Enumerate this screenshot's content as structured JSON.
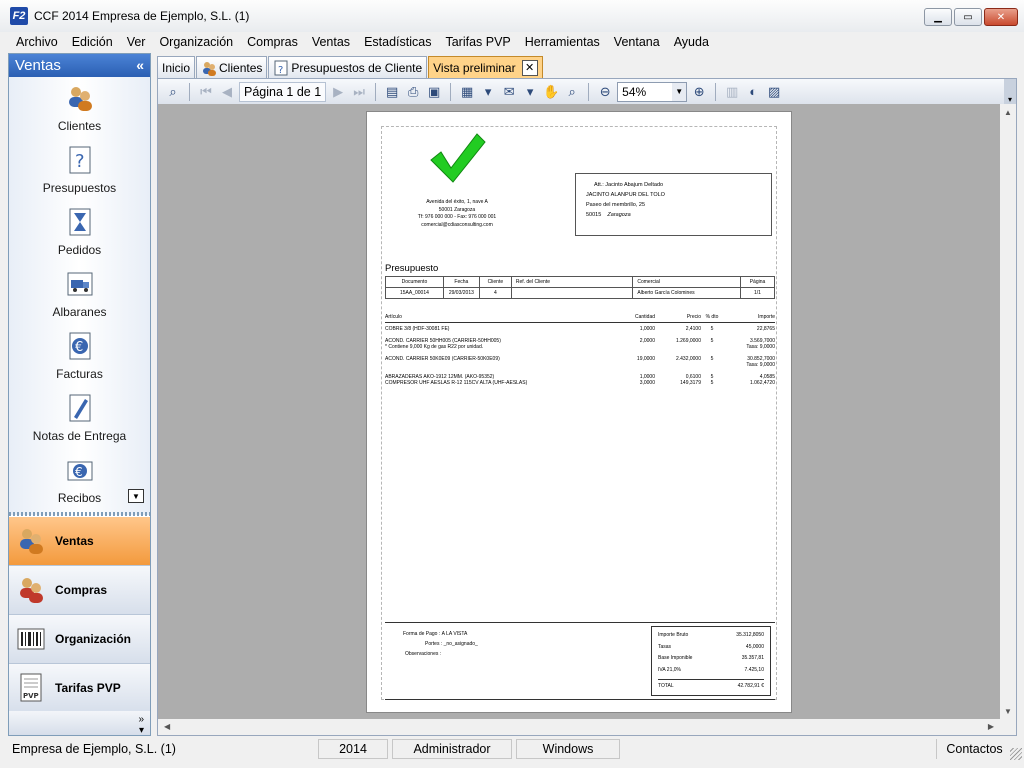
{
  "window": {
    "title": "CCF 2014 Empresa de Ejemplo, S.L. (1)",
    "app_icon": "F2"
  },
  "menu": [
    "Archivo",
    "Edición",
    "Ver",
    "Organización",
    "Compras",
    "Ventas",
    "Estadísticas",
    "Tarifas PVP",
    "Herramientas",
    "Ventana",
    "Ayuda"
  ],
  "sidebar": {
    "title": "Ventas",
    "items": [
      {
        "label": "Clientes",
        "icon": "clients-icon"
      },
      {
        "label": "Presupuestos",
        "icon": "quote-icon"
      },
      {
        "label": "Pedidos",
        "icon": "hourglass-icon"
      },
      {
        "label": "Albaranes",
        "icon": "truck-icon"
      },
      {
        "label": "Facturas",
        "icon": "euro-invoice-icon"
      },
      {
        "label": "Notas de Entrega",
        "icon": "pen-icon"
      },
      {
        "label": "Recibos",
        "icon": "euro-receipt-icon"
      }
    ],
    "groups": [
      {
        "label": "Ventas",
        "active": true
      },
      {
        "label": "Compras",
        "active": false
      },
      {
        "label": "Organización",
        "active": false
      },
      {
        "label": "Tarifas PVP",
        "active": false
      }
    ]
  },
  "tabs": [
    "Inicio",
    "Clientes",
    "Presupuestos de Cliente",
    "Vista preliminar"
  ],
  "toolbar": {
    "page_label": "Página 1 de 1",
    "zoom": "54%"
  },
  "document": {
    "company_address": [
      "Avenida del éxito, 1, nave A",
      "50001 Zaragoza",
      "Tf: 976 000 000 - Fax: 976 000 001",
      "comercial@cdiasconsulting.com"
    ],
    "client": [
      "Att.: Jacinto Abajum Deltado",
      "JACINTO ALANPUR DEL TOLO",
      "Paseo del membrillo, 25",
      "50015",
      "Zaragoza"
    ],
    "title": "Presupuesto",
    "header_cols": [
      "Documento",
      "Fecha",
      "Cliente",
      "Ref. del Cliente",
      "Comercial",
      "Página"
    ],
    "header_vals": [
      "15AA_00014",
      "29/03/2013",
      "4",
      "",
      "Alberto García Colomines",
      "1/1"
    ],
    "line_cols": [
      "Artículo",
      "Cantidad",
      "Precio",
      "% dto",
      "Importe"
    ],
    "lines": [
      {
        "art": "COBRE 3/8 (HDF-30081       FE)",
        "cant": "1,0000",
        "pre": "2,4100",
        "dto": "5",
        "imp": "22,8765"
      },
      {
        "art": "ACOND. CARRIER 50HH005 (CARRIER-50HH005)",
        "cant": "2,0000",
        "pre": "1.269,0000",
        "dto": "5",
        "imp": "3.569,7000"
      },
      {
        "art": "   * Contiene 9,000 Kg de gas R22 por unidad.",
        "cant": "",
        "pre": "",
        "dto": "",
        "imp": "Tasa: 9,0000"
      },
      {
        "art": "ACOND. CARRIER 50K0E09 (CARRIER-50K0E09)",
        "cant": "19,0000",
        "pre": "2.432,0000",
        "dto": "5",
        "imp": "30.852,7000"
      },
      {
        "art": "",
        "cant": "",
        "pre": "",
        "dto": "",
        "imp": "Tasa: 9,0000"
      },
      {
        "art": "ABRAZADERAS AKO-1912 12MM. (AKO-95352)",
        "cant": "1,0000",
        "pre": "0,6100",
        "dto": "5",
        "imp": "4,0585"
      },
      {
        "art": "COMPRESOR UHF AESLAS R-12 115CV ALTA (UHF-AESLAS)",
        "cant": "3,0000",
        "pre": "149,3179",
        "dto": "5",
        "imp": "1.062,4720"
      }
    ],
    "payment": {
      "forma_label": "Forma de Pago",
      "forma": "A LA VISTA",
      "portes_label": "Portes",
      "portes": "_no_asignado_",
      "obs_label": "Observaciones"
    },
    "totals": [
      {
        "label": "Importe Bruto",
        "value": "35.312,8050"
      },
      {
        "label": "Tasas",
        "value": "45,0000"
      },
      {
        "label": "Base Imponible",
        "value": "35.357,81"
      },
      {
        "label": "IVA   21,0%",
        "value": "7.425,10"
      }
    ],
    "total": {
      "label": "TOTAL",
      "value": "42.782,91 €"
    }
  },
  "status": {
    "company": "Empresa de Ejemplo, S.L. (1)",
    "year": "2014",
    "user": "Administrador",
    "os": "Windows",
    "contacts": "Contactos"
  }
}
